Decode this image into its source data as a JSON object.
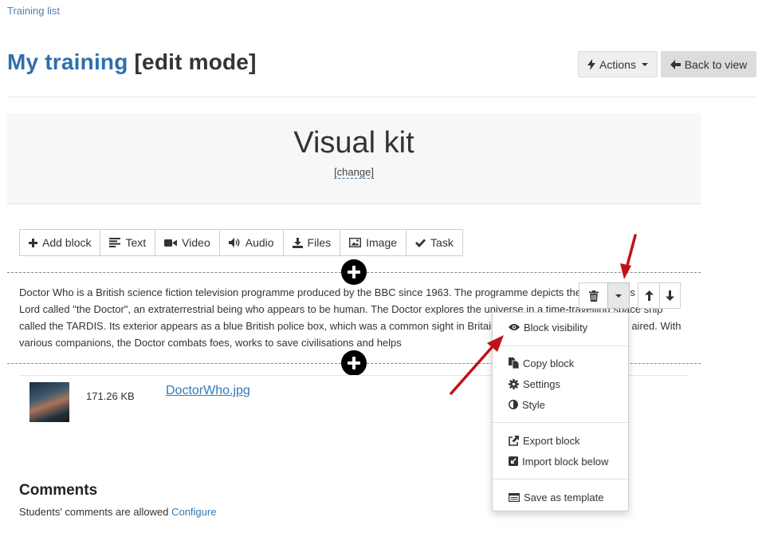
{
  "breadcrumb": {
    "label": "Training list"
  },
  "header": {
    "title_link": "My training",
    "title_suffix": " [edit mode]",
    "actions_label": "Actions",
    "back_label": "Back to view"
  },
  "kit": {
    "title": "Visual kit",
    "change_label": "[change]"
  },
  "toolbar": {
    "items": [
      {
        "label": "Add block",
        "icon": "plus-icon"
      },
      {
        "label": "Text",
        "icon": "align-left-icon"
      },
      {
        "label": "Video",
        "icon": "video-camera-icon"
      },
      {
        "label": "Audio",
        "icon": "volume-icon"
      },
      {
        "label": "Files",
        "icon": "download-icon"
      },
      {
        "label": "Image",
        "icon": "picture-icon"
      },
      {
        "label": "Task",
        "icon": "check-icon"
      }
    ]
  },
  "block": {
    "text": "Doctor Who is a British science fiction television programme produced by the BBC since 1963. The programme depicts the adventures of a Time Lord called \"the Doctor\", an extraterrestrial being who appears to be human. The Doctor explores the universe in a time-travelling space ship called the TARDIS. Its exterior appears as a blue British police box, which was a common sight in Britain in 1963 when the series first aired. With various companions, the Doctor combats foes, works to save civilisations and helps"
  },
  "file": {
    "size": "171.26 KB",
    "name": "DoctorWho.jpg"
  },
  "dropdown": {
    "items": [
      {
        "label": "Block visibility",
        "icon": "eye-icon"
      },
      {
        "label": "Copy block",
        "icon": "copy-icon"
      },
      {
        "label": "Settings",
        "icon": "gear-icon"
      },
      {
        "label": "Style",
        "icon": "adjust-icon"
      },
      {
        "label": "Export block",
        "icon": "external-link-icon"
      },
      {
        "label": "Import block below",
        "icon": "import-icon"
      },
      {
        "label": "Save as template",
        "icon": "template-icon"
      }
    ]
  },
  "comments": {
    "title": "Comments",
    "text": "Students' comments are allowed ",
    "configure_label": "Configure"
  },
  "colors": {
    "accent": "#2f6fac",
    "link": "#337ab7",
    "annotation_arrow": "#c0111b"
  }
}
